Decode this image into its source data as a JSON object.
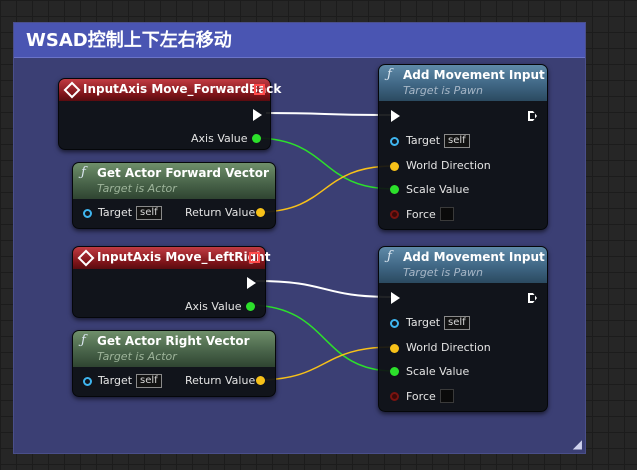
{
  "comment": {
    "title": "WSAD控制上下左右移动",
    "resize_glyph": "◢"
  },
  "nodes": {
    "input_forward": {
      "title": "InputAxis Move_ForwardBack",
      "axis_value": "Axis Value",
      "icon": "input-event-icon"
    },
    "get_forward": {
      "title": "Get Actor Forward Vector",
      "subtitle": "Target is Actor",
      "target": "Target",
      "target_value": "self",
      "return_value": "Return Value",
      "icon": "function-icon"
    },
    "add_move_1": {
      "title": "Add Movement Input",
      "subtitle": "Target is Pawn",
      "target": "Target",
      "target_value": "self",
      "world_direction": "World Direction",
      "scale_value": "Scale Value",
      "force": "Force",
      "icon": "function-icon"
    },
    "input_right": {
      "title": "InputAxis Move_LeftRight",
      "axis_value": "Axis Value",
      "icon": "input-event-icon"
    },
    "get_right": {
      "title": "Get Actor Right Vector",
      "subtitle": "Target is Actor",
      "target": "Target",
      "target_value": "self",
      "return_value": "Return Value",
      "icon": "function-icon"
    },
    "add_move_2": {
      "title": "Add Movement Input",
      "subtitle": "Target is Pawn",
      "target": "Target",
      "target_value": "self",
      "world_direction": "World Direction",
      "scale_value": "Scale Value",
      "force": "Force",
      "icon": "function-icon"
    }
  },
  "colors": {
    "exec_wire": "#ffffff",
    "float_wire": "#2ce02b",
    "vector_wire": "#f7c119",
    "object_pin": "#3fb5ef",
    "comment_header": "#4a55b2"
  }
}
